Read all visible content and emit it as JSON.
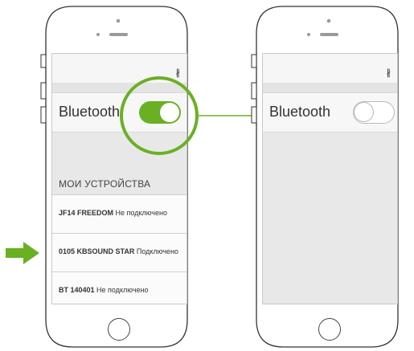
{
  "colors": {
    "accent": "#6ab023",
    "outline": "#333333",
    "screen_bg": "#e8e8e8"
  },
  "icons": {
    "status_bluetooth": "bluetooth-icon",
    "arrow": "arrow-right-icon"
  },
  "left_phone": {
    "status_bluetooth_glyph": "∦",
    "bluetooth_label": "Bluetooth",
    "toggle_state": "on",
    "section_header": "МОИ УСТРОЙСТВА",
    "devices": [
      {
        "name": "JF14 FREEDOM",
        "status": "Не подключено"
      },
      {
        "name": "0105 KBSOUND STAR",
        "status": "Подключено"
      },
      {
        "name": "BT 140401",
        "status": "Не подключено"
      }
    ]
  },
  "right_phone": {
    "status_bluetooth_glyph": "∦",
    "bluetooth_label": "Bluetooth",
    "toggle_state": "off"
  }
}
